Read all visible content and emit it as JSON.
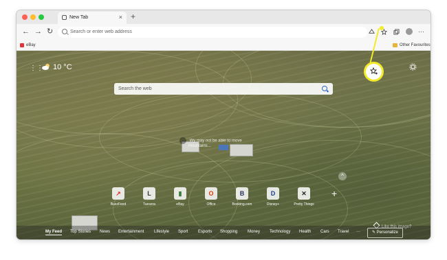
{
  "browser": {
    "tab": {
      "title": "New Tab",
      "close_glyph": "×"
    },
    "new_tab_glyph": "+",
    "nav": {
      "back": "←",
      "forward": "→",
      "reload": "↻"
    },
    "address_placeholder": "Search or enter web address",
    "toolbar_icons": [
      "read-aloud-icon",
      "favorites-star-icon",
      "collections-icon",
      "profile-avatar",
      "more-menu-icon"
    ],
    "more_glyph": "···"
  },
  "favorites_bar": {
    "items": [
      {
        "label": "eBay"
      }
    ],
    "other_label": "Other Favourites"
  },
  "weather": {
    "temp": "10 °C"
  },
  "search": {
    "placeholder": "Search the web"
  },
  "image_info": {
    "line1": "Wy may not be able to move",
    "line2": "mountains..."
  },
  "quick_links": [
    {
      "label": "BuzzFeed",
      "glyph": "↗",
      "color": "#e32b2b"
    },
    {
      "label": "Tuesera",
      "glyph": "L",
      "color": "#333333"
    },
    {
      "label": "eBay",
      "glyph": "▮",
      "color": "#3a7d3a"
    },
    {
      "label": "Office",
      "glyph": "O",
      "color": "#d83b01"
    },
    {
      "label": "Booking.com",
      "glyph": "B",
      "color": "#1f2f5e"
    },
    {
      "label": "Disney+",
      "glyph": "D",
      "color": "#1b3c8c"
    },
    {
      "label": "Pretty Things",
      "glyph": "✕",
      "color": "#222222"
    }
  ],
  "add_link_glyph": "+",
  "collapse_glyph": "^",
  "like_image": "Like this image?",
  "feed": {
    "tabs": [
      "My Feed",
      "Top Stories",
      "News",
      "Entertainment",
      "Lifestyle",
      "Sport",
      "Esports",
      "Shopping",
      "Money",
      "Technology",
      "Health",
      "Cars",
      "Travel",
      "···"
    ],
    "active_tab": "My Feed",
    "personalize": "Personalize"
  },
  "colors": {
    "callout": "#f2ea2a",
    "accent": "#2c63c7"
  }
}
